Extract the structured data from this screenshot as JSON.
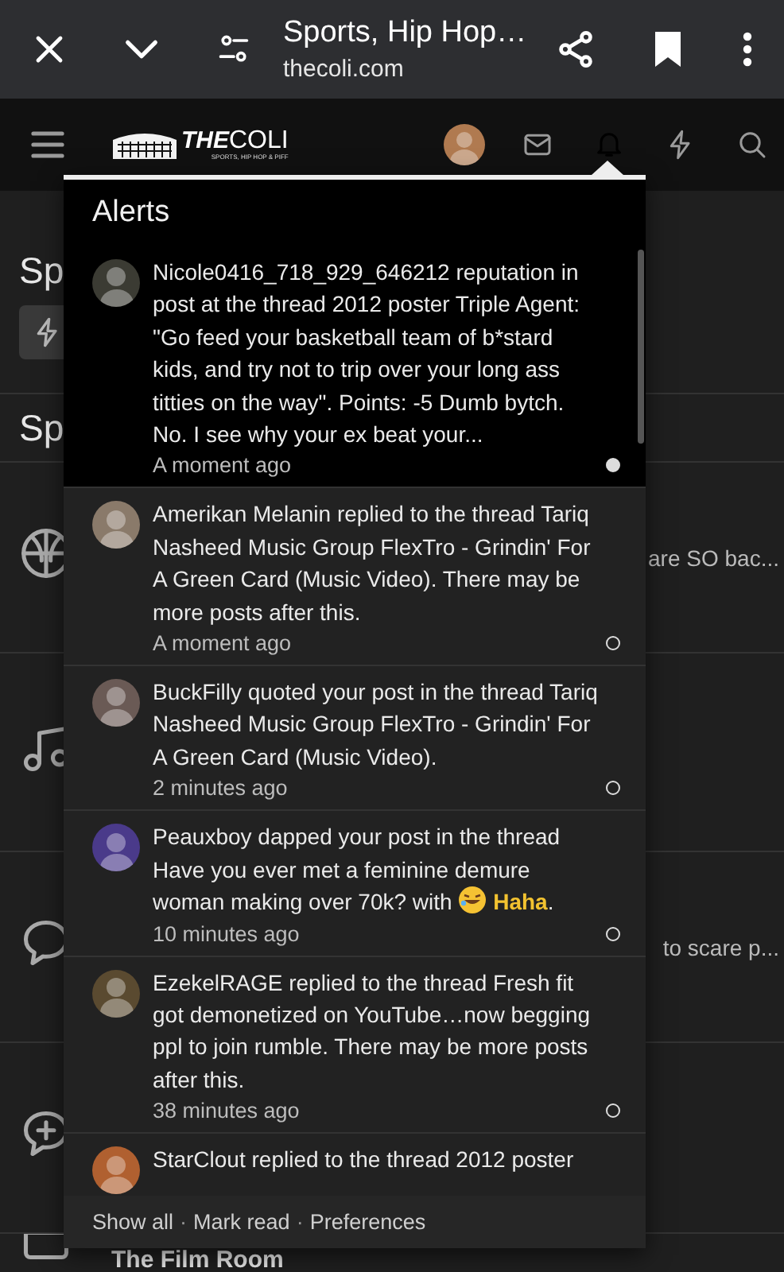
{
  "browser_bar": {
    "title": "Sports, Hip Hop…",
    "url": "thecoli.com"
  },
  "site_nav": {
    "logo": {
      "bold": "THE",
      "light": "COLI",
      "tagline": "SPORTS, HIP HOP & PIFF"
    }
  },
  "page": {
    "headings": [
      "Sp",
      "Sp"
    ],
    "forum_rows": [
      {
        "kind": "basketball",
        "snippet": "are SO bac..."
      },
      {
        "kind": "music"
      },
      {
        "kind": "chat",
        "snippet": "to scare p..."
      },
      {
        "kind": "chatplus"
      },
      {
        "kind": "calendar",
        "title": "The Film Room"
      }
    ]
  },
  "alerts": {
    "title": "Alerts",
    "items": [
      {
        "text": "Nicole0416_718_929_646212 reputation in post at the thread 2012 poster Triple Agent: \"Go feed your basketball team of b*stard kids, and try not to trip over your long ass titties on the way\". Points: -5 Dumb bytch. No. I see why your ex beat your...",
        "time": "A moment ago",
        "unread": true
      },
      {
        "text": "Amerikan Melanin replied to the thread Tariq Nasheed Music Group FlexTro - Grindin' For A Green Card (Music Video). There may be more posts after this.",
        "time": "A moment ago",
        "unread": false
      },
      {
        "text": "BuckFilly quoted your post in the thread Tariq Nasheed Music Group FlexTro - Grindin' For A Green Card (Music Video).",
        "time": "2 minutes ago",
        "unread": false
      },
      {
        "text": "Peauxboy dapped your post in the thread Have you ever met a feminine demure woman making over 70k? with",
        "reaction": "Haha",
        "suffix": ".",
        "time": "10 minutes ago",
        "unread": false
      },
      {
        "text": "EzekelRAGE replied to the thread Fresh fit got demonetized on YouTube…now begging ppl to join rumble. There may be more posts after this.",
        "time": "38 minutes ago",
        "unread": false
      },
      {
        "text": "StarClout replied to the thread 2012 poster"
      }
    ],
    "footer": {
      "links": [
        "Show all",
        "Mark read",
        "Preferences"
      ],
      "separator": "·"
    }
  }
}
